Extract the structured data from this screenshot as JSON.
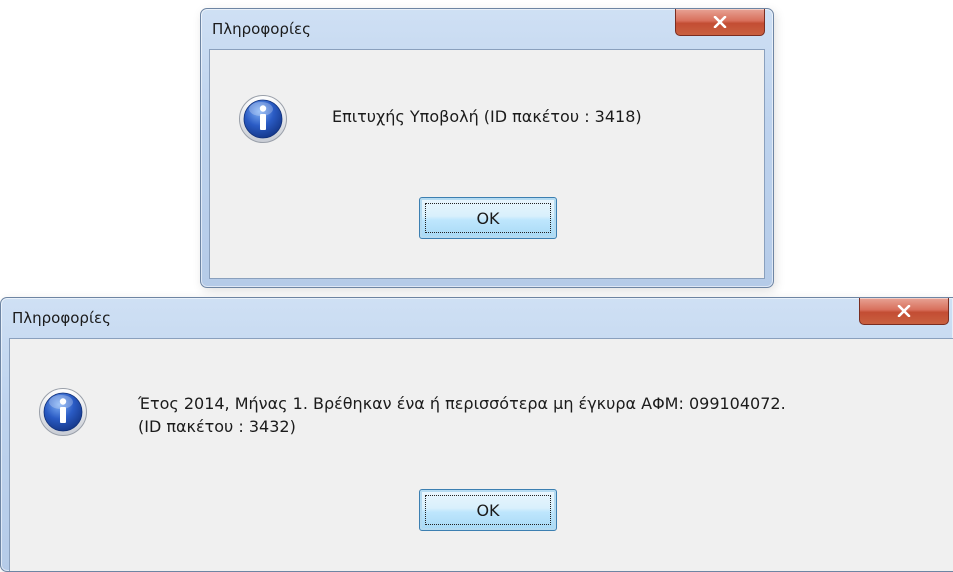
{
  "dialogs": [
    {
      "title": "Πληροφορίες",
      "icon": "information-icon",
      "message_lines": [
        "Επιτυχής Υποβολή (ID πακέτου : 3418)"
      ],
      "ok_label": "OK"
    },
    {
      "title": "Πληροφορίες",
      "icon": "information-icon",
      "message_lines": [
        "Έτος 2014, Μήνας 1. Βρέθηκαν ένα ή περισσότερα μη έγκυρα ΑΦΜ: 099104072.",
        "(ID πακέτου : 3432)"
      ],
      "ok_label": "OK"
    }
  ],
  "colors": {
    "frame": "#bed3ee",
    "client": "#f0f0f0",
    "close_button": "#c9503a",
    "ok_button_border": "#3c7fb1",
    "info_icon_blue": "#2a5bc4"
  }
}
